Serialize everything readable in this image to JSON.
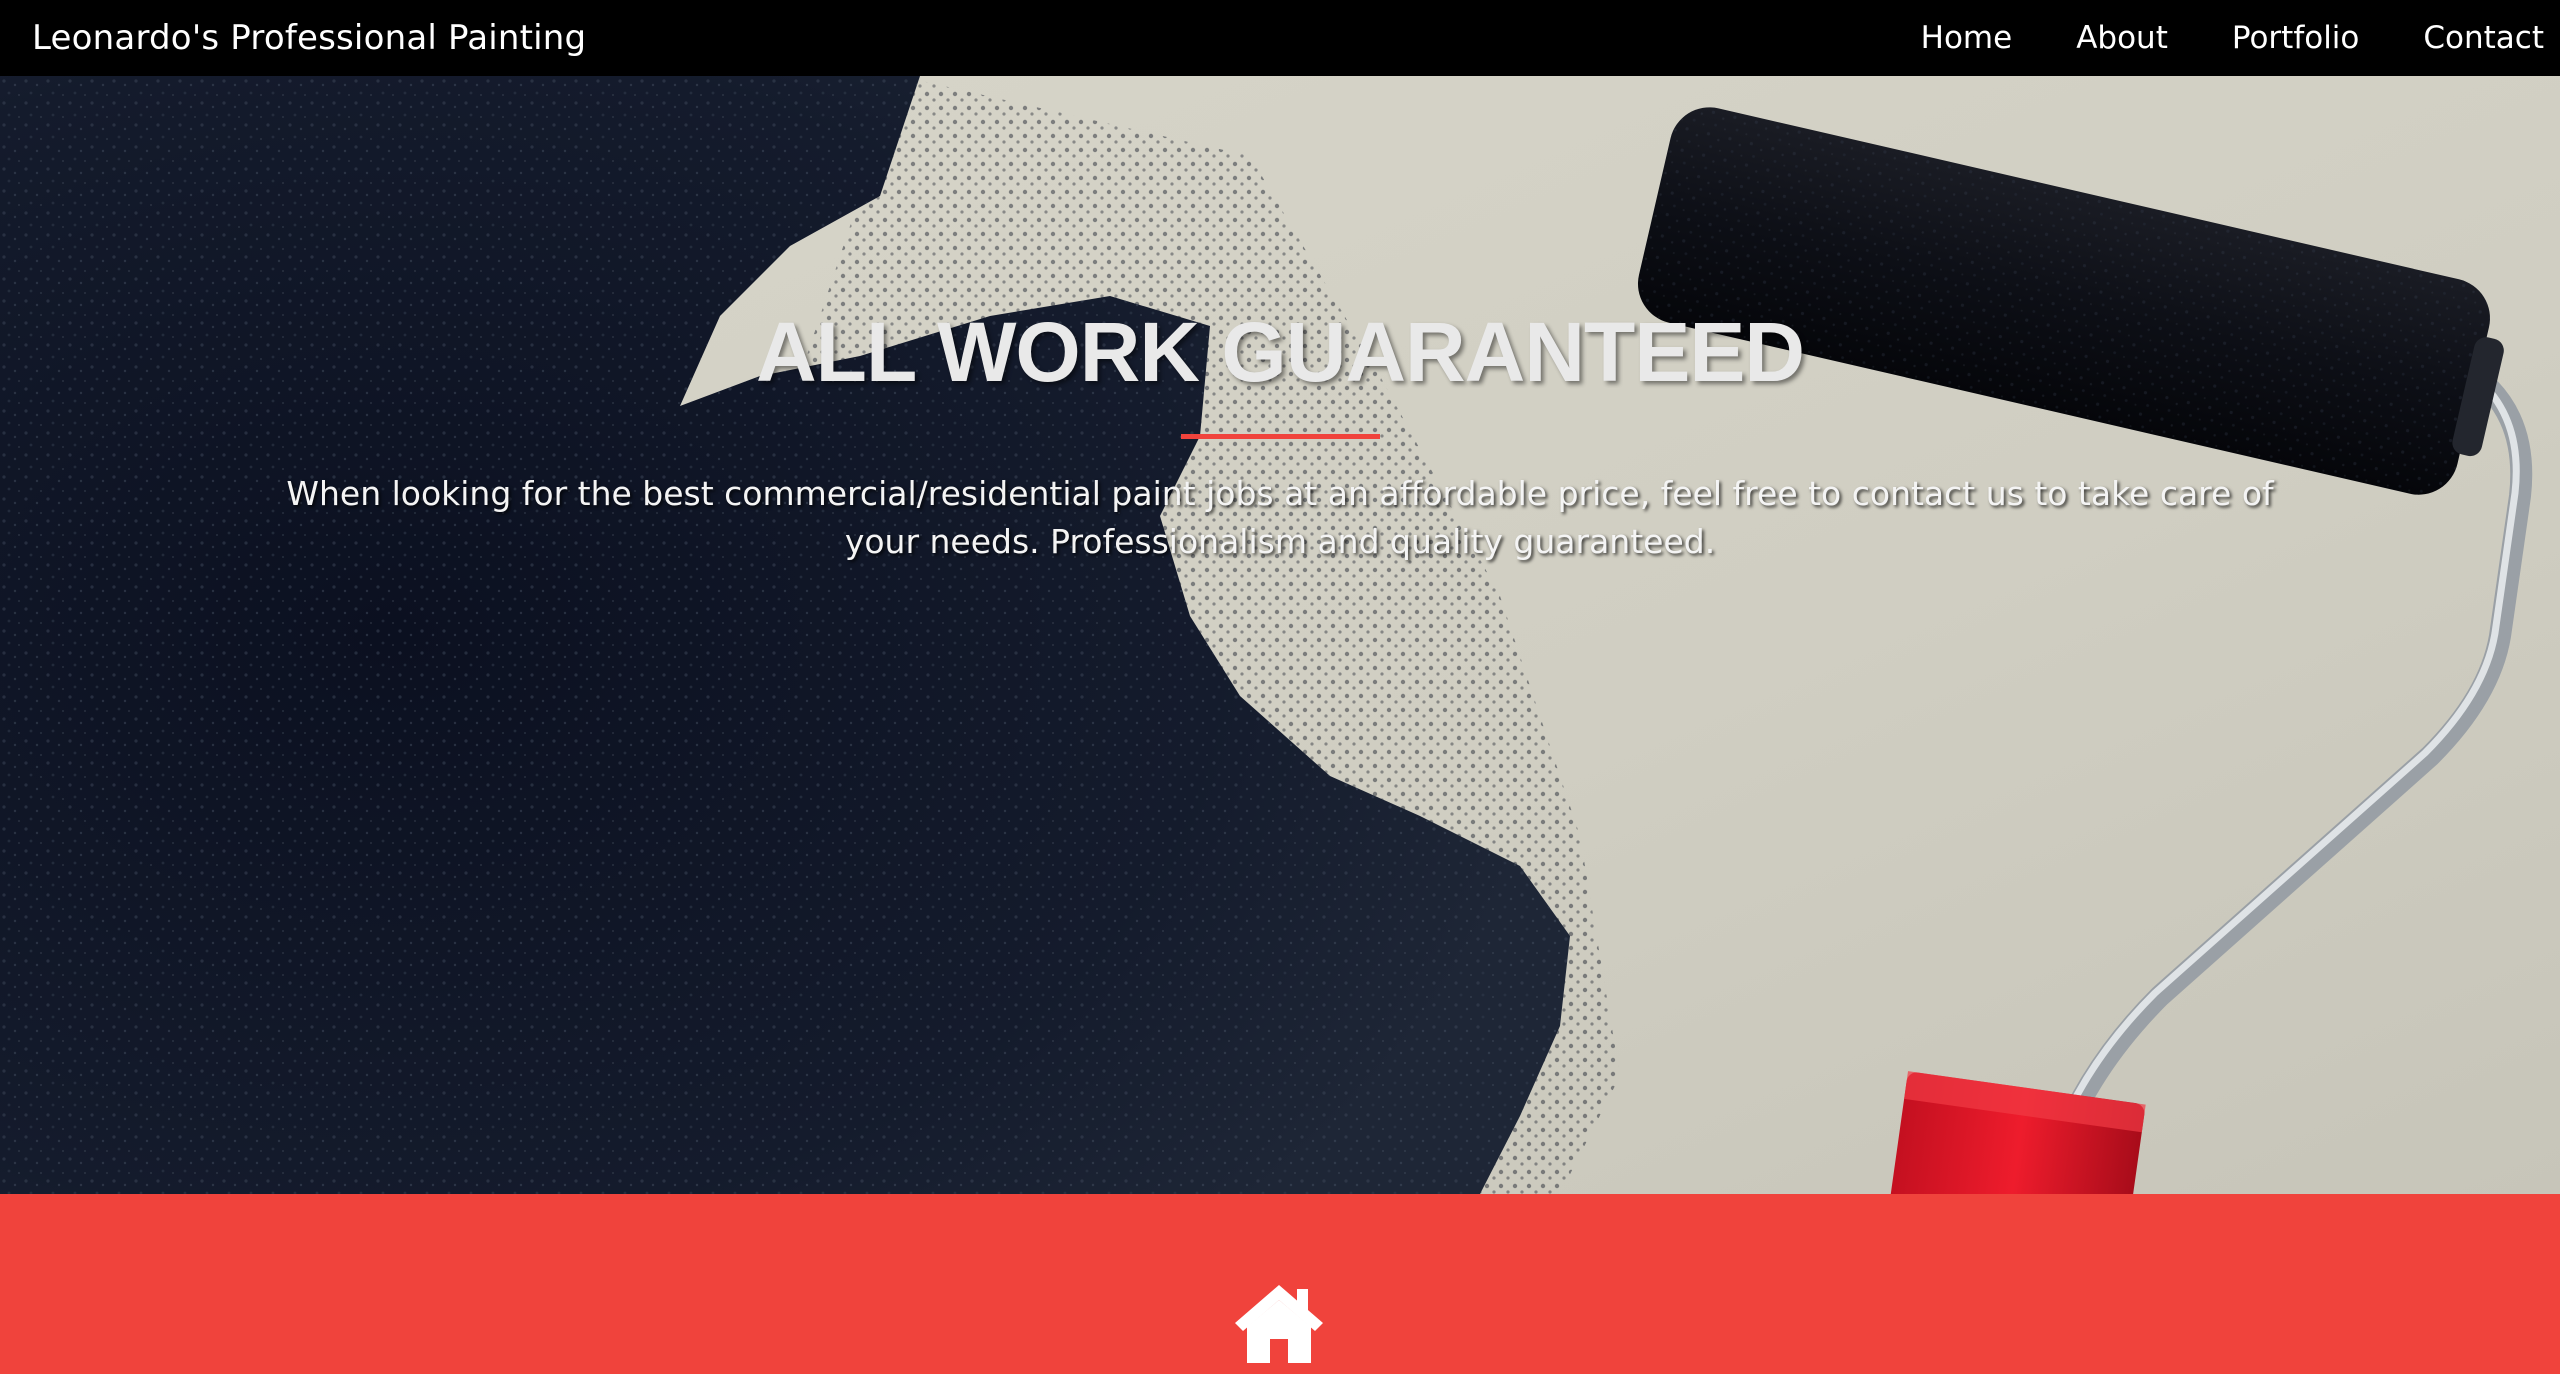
{
  "navbar": {
    "brand": "Leonardo's Professional Painting",
    "links": [
      {
        "label": "Home"
      },
      {
        "label": "About"
      },
      {
        "label": "Portfolio"
      },
      {
        "label": "Contact"
      }
    ]
  },
  "hero": {
    "title": "ALL WORK GUARANTEED",
    "text": "When looking for the best commercial/residential paint jobs at an affordable price, feel free to contact us to take care of your needs. Professionalism and quality guaranteed.",
    "background_image": "paint-roller-dark-paint-on-wall",
    "accent_color": "#f0433c"
  },
  "services": {
    "background_color": "#f0433c",
    "icon": "home-icon"
  }
}
